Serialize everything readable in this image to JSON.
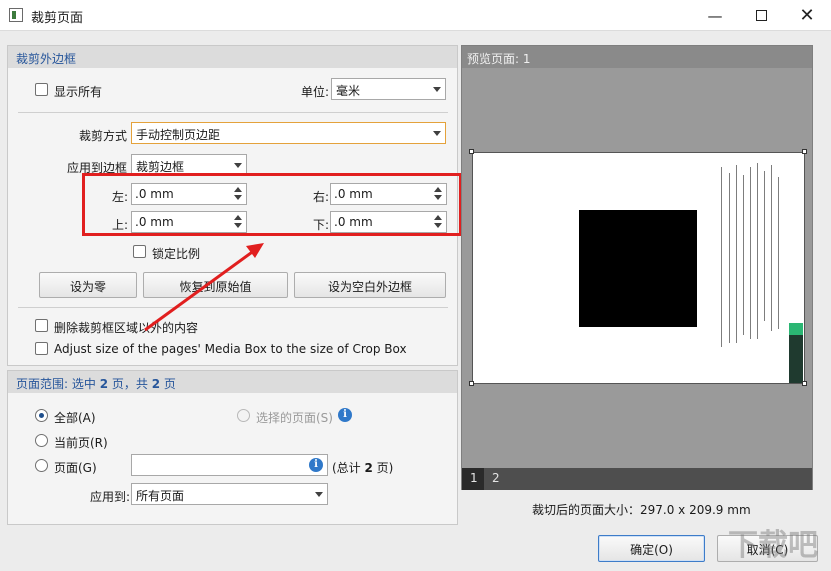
{
  "window": {
    "title": "裁剪页面"
  },
  "crop_margin": {
    "section_title": "裁剪外边框",
    "show_all_label": "显示所有",
    "unit_label": "单位:",
    "unit_value": "毫米",
    "crop_method_label": "裁剪方式",
    "crop_method_value": "手动控制页边距",
    "apply_to_box_label": "应用到边框",
    "apply_to_box_value": "裁剪边框",
    "left_label": "左:",
    "left_value": ".0 mm",
    "right_label": "右:",
    "right_value": ".0 mm",
    "top_label": "上:",
    "top_value": ".0 mm",
    "bottom_label": "下:",
    "bottom_value": ".0 mm",
    "lock_ratio_label": "锁定比例",
    "set_zero_button": "设为零",
    "restore_button": "恢复到原始值",
    "set_blank_button": "设为空白外边框",
    "delete_outside_label": "删除裁剪框区域以外的内容",
    "adjust_media_label": "Adjust size of the pages' Media Box to the size of Crop Box"
  },
  "page_range": {
    "title_prefix": "页面范围: 选中 ",
    "selected_count": "2",
    "title_mid": " 页，共 ",
    "total_count": "2",
    "title_suffix": " 页",
    "all_label": "全部(A)",
    "selected_pages_label": "选择的页面(S)",
    "current_page_label": "当前页(R)",
    "pages_label": "页面(G)",
    "pages_input_value": "",
    "total_prefix": "(总计 ",
    "total_suffix": " 页)",
    "apply_to_label": "应用到:",
    "apply_to_value": "所有页面"
  },
  "preview": {
    "title": "预览页面: 1",
    "tabs": [
      "1",
      "2"
    ],
    "size_text": "裁切后的页面大小：297.0 x 209.9 mm"
  },
  "footer": {
    "ok_button": "确定(O)",
    "cancel_button": "取消(C)"
  },
  "watermark": {
    "text": "下载吧"
  },
  "colors": {
    "accent_blue": "#27569b",
    "annotation_red": "#e11f1f",
    "focus_orange": "#e4a23b"
  }
}
